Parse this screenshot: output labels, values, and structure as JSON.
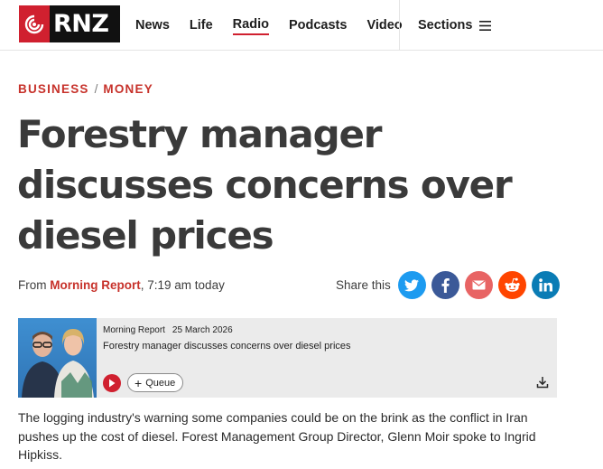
{
  "header": {
    "logo_text": "RNZ",
    "nav": [
      "News",
      "Life",
      "Radio",
      "Podcasts",
      "Video"
    ],
    "active_nav": "Radio",
    "sections_label": "Sections",
    "brand_color": "#d0202f"
  },
  "breadcrumb": {
    "first": "BUSINESS",
    "separator": "/",
    "second": "MONEY"
  },
  "article": {
    "title": "Forestry manager discusses concerns over diesel prices",
    "byline_prefix": "From",
    "byline_program": "Morning Report",
    "byline_time": ", 7:19 am today",
    "share_label": "Share this",
    "share_icons": [
      "twitter-icon",
      "facebook-icon",
      "email-icon",
      "reddit-icon",
      "linkedin-icon"
    ]
  },
  "audio": {
    "program": "Morning Report",
    "date": "25 March 2026",
    "title": "Forestry manager discusses concerns over diesel prices",
    "queue_label": "Queue"
  },
  "body": {
    "paragraph": "The logging industry's warning some companies could be on the brink as the conflict in Iran pushes up the cost of diesel. Forest Management Group Director, Glenn Moir spoke to Ingrid Hipkiss."
  }
}
